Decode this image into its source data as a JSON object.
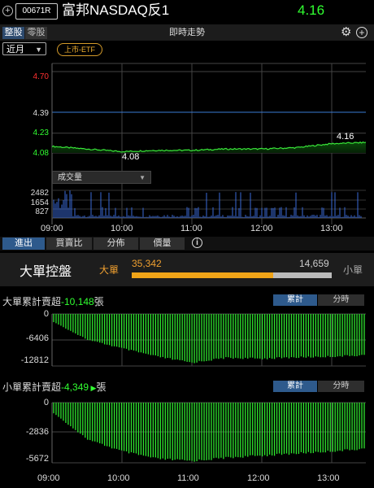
{
  "header": {
    "code": "00671R",
    "name": "富邦NASDAQ反1",
    "price": "4.16"
  },
  "toolbar": {
    "seg_whole": "整股",
    "seg_odd": "零股",
    "title": "即時走勢",
    "period": "近月",
    "tag": "上市-ETF"
  },
  "price_chart": {
    "y_labels": [
      "4.70",
      "4.39",
      "4.23",
      "4.08"
    ],
    "min_label": "4.08",
    "last_label": "4.16",
    "volume_selector": "成交量",
    "volume_labels": [
      "2482",
      "1654",
      "827"
    ],
    "x_labels": [
      "09:00",
      "10:00",
      "11:00",
      "12:00",
      "13:00"
    ]
  },
  "tabs": [
    "進出",
    "買賣比",
    "分佈",
    "價量"
  ],
  "big_small": {
    "title": "大單控盤",
    "big_label": "大單",
    "big_value": "35,342",
    "small_value": "14,659",
    "small_label": "小單",
    "big_ratio": 0.7068
  },
  "big_cum": {
    "title_prefix": "大單累計賣超",
    "value": "-10,148",
    "unit": "張",
    "btn_cum": "累計",
    "btn_period": "分時",
    "y_labels": [
      "0",
      "-6406",
      "-12812"
    ]
  },
  "small_cum": {
    "title_prefix": "小單累計賣超",
    "value": "-4,349",
    "unit": "張",
    "btn_cum": "累計",
    "btn_period": "分時",
    "y_labels": [
      "0",
      "-2836",
      "-5672"
    ]
  },
  "bottom_x_labels": [
    "09:00",
    "10:00",
    "11:00",
    "12:00",
    "13:00"
  ],
  "colors": {
    "up": "#31ff31",
    "down_red": "#ff3030",
    "big": "#f0a418",
    "ref_line": "#3a7bd5"
  },
  "chart_data": [
    {
      "type": "line",
      "title": "",
      "xlabel": "",
      "ylabel": "",
      "x": [
        "09:00",
        "09:30",
        "10:00",
        "10:30",
        "11:00",
        "11:30",
        "12:00",
        "12:30",
        "13:00",
        "13:30"
      ],
      "series": [
        {
          "values": [
            4.13,
            4.11,
            4.09,
            4.1,
            4.1,
            4.11,
            4.11,
            4.12,
            4.15,
            4.16
          ]
        }
      ],
      "ylim": [
        4.08,
        4.7
      ]
    },
    {
      "type": "bar",
      "title": "",
      "ylabel": "",
      "ylim": [
        0,
        2482
      ],
      "x_range": [
        "09:00",
        "13:30"
      ]
    },
    {
      "type": "bar",
      "title": "大單累計賣超",
      "x": [
        "09:00",
        "09:30",
        "10:00",
        "10:30",
        "11:00",
        "11:30",
        "12:00",
        "12:30",
        "13:00",
        "13:30"
      ],
      "values": [
        -2000,
        -6406,
        -8500,
        -10500,
        -12000,
        -10800,
        -11000,
        -10700,
        -10500,
        -10148
      ],
      "ylim": [
        -12812,
        0
      ]
    },
    {
      "type": "bar",
      "title": "小單累計賣超",
      "x": [
        "09:00",
        "09:30",
        "10:00",
        "10:30",
        "11:00",
        "11:30",
        "12:00",
        "12:30",
        "13:00",
        "13:30"
      ],
      "values": [
        -1000,
        -3500,
        -4600,
        -5300,
        -5500,
        -5200,
        -5000,
        -4800,
        -4600,
        -4349
      ],
      "ylim": [
        -5672,
        0
      ]
    }
  ]
}
